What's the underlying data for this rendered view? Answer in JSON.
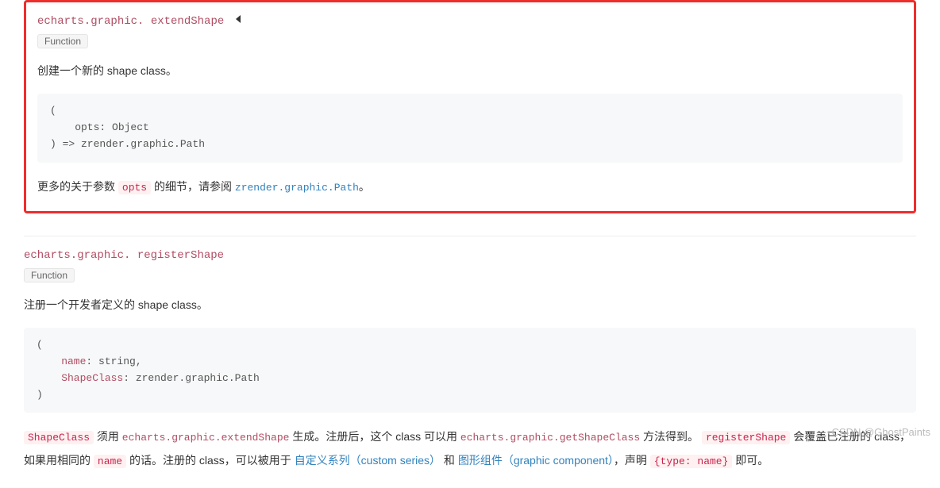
{
  "section1": {
    "namespace": "echarts.graphic. ",
    "method": "extendShape",
    "tag": "Function",
    "desc": "创建一个新的 shape class。",
    "code_l1": "(",
    "code_l2": "    opts: Object",
    "code_l3": ") => zrender.graphic.Path",
    "para_pre": "更多的关于参数 ",
    "code_opts": "opts",
    "para_mid": " 的细节，请参阅 ",
    "link_text": "zrender.graphic.Path",
    "para_end": "。"
  },
  "section2": {
    "namespace": "echarts.graphic. ",
    "method": "registerShape",
    "tag": "Function",
    "desc": "注册一个开发者定义的 shape class。",
    "code_l1": "(",
    "code_l2_a": "    name",
    "code_l2_b": ": string,",
    "code_l3_a": "    ShapeClass",
    "code_l3_b": ": zrender.graphic.Path",
    "code_l4": ")",
    "p_shapeclass": "ShapeClass",
    "p_t1": " 须用 ",
    "p_extend": "echarts.graphic.extendShape",
    "p_t2": " 生成。注册后，这个 class 可以用 ",
    "p_getshape": "echarts.graphic.getShapeClass",
    "p_t3": " 方法得到。 ",
    "p_register": "registerShape",
    "p_t4": " 会覆盖已注册的 class，如果用相同的 ",
    "p_name": "name",
    "p_t5": " 的话。注册的 class，可以被用于 ",
    "p_link1": "自定义系列（custom series）",
    "p_t6": " 和 ",
    "p_link2": "图形组件（graphic component）",
    "p_t7": "，声明 ",
    "p_typecode": "{type: name}",
    "p_t8": " 即可。"
  },
  "watermark": "CSDN @GhostPaints"
}
